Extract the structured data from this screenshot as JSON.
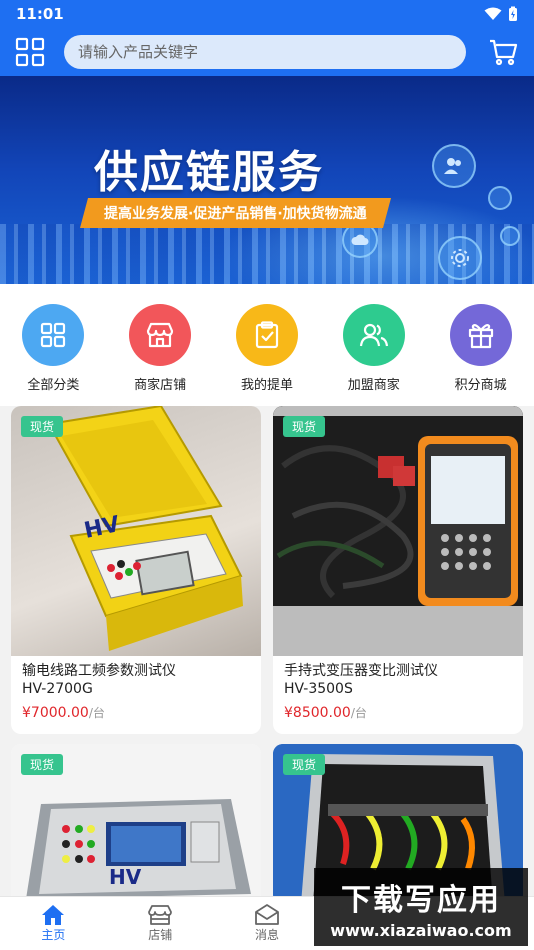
{
  "status": {
    "time": "11:01"
  },
  "search": {
    "placeholder": "请输入产品关键字"
  },
  "banner": {
    "title": "供应链服务",
    "subtitle": "提高业务发展·促进产品销售·加快货物流通"
  },
  "quick_menu": [
    {
      "label": "全部分类",
      "color": "#4da8f2",
      "icon": "grid-icon"
    },
    {
      "label": "商家店铺",
      "color": "#f2565a",
      "icon": "store-icon"
    },
    {
      "label": "我的提单",
      "color": "#f8b818",
      "icon": "clipboard-check-icon"
    },
    {
      "label": "加盟商家",
      "color": "#2ecb8f",
      "icon": "people-icon"
    },
    {
      "label": "积分商城",
      "color": "#7468d8",
      "icon": "gift-icon"
    }
  ],
  "products": [
    {
      "tag": "现货",
      "title": "输电线路工频参数测试仪",
      "model": "HV-2700G",
      "price": "¥7000.00",
      "unit": "/台"
    },
    {
      "tag": "现货",
      "title": "手持式变压器变比测试仪",
      "model": "HV-3500S",
      "price": "¥8500.00",
      "unit": "/台"
    },
    {
      "tag": "现货"
    },
    {
      "tag": "现货"
    }
  ],
  "tabbar": [
    {
      "label": "主页",
      "icon": "home-icon",
      "active": true
    },
    {
      "label": "店铺",
      "icon": "store-icon",
      "active": false
    },
    {
      "label": "消息",
      "icon": "mail-icon",
      "active": false
    }
  ],
  "watermark": {
    "big": "下载写应用",
    "small": "www.xiazaiwao.com"
  },
  "colors": {
    "primary": "#1e6ff2",
    "price": "#e0262b",
    "tag": "#36c48e",
    "banner_accent": "#f29a1e"
  }
}
